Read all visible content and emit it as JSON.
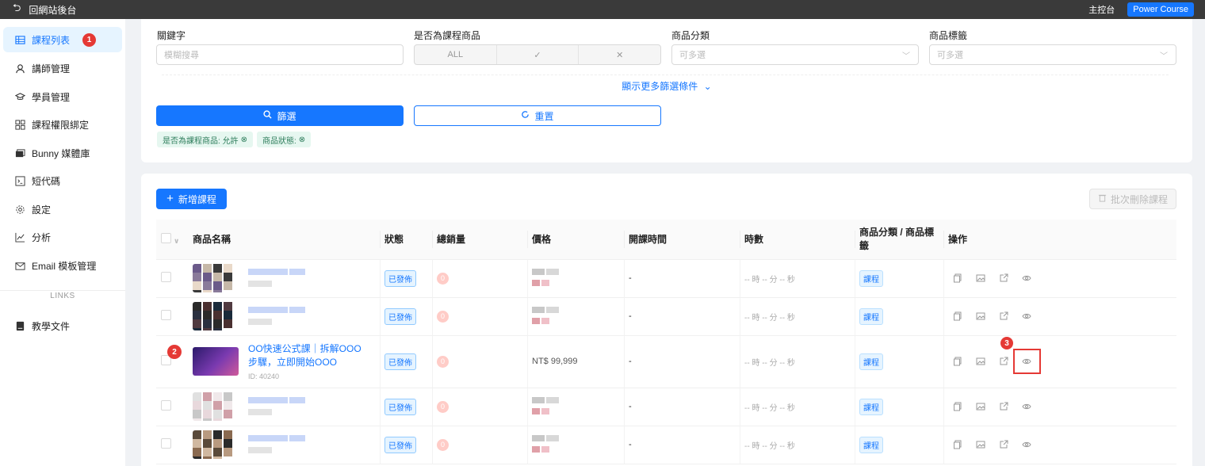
{
  "topbar": {
    "back_label": "回網站後台",
    "dashboard_label": "主控台",
    "brand_button": "Power Course"
  },
  "sidebar": {
    "items": [
      {
        "label": "課程列表",
        "icon": "table-icon",
        "active": true
      },
      {
        "label": "講師管理",
        "icon": "user-icon"
      },
      {
        "label": "學員管理",
        "icon": "graduation-icon"
      },
      {
        "label": "課程權限綁定",
        "icon": "grid-icon"
      },
      {
        "label": "Bunny 媒體庫",
        "icon": "media-icon"
      },
      {
        "label": "短代碼",
        "icon": "code-icon"
      },
      {
        "label": "設定",
        "icon": "gear-icon"
      },
      {
        "label": "分析",
        "icon": "chart-icon"
      },
      {
        "label": "Email 模板管理",
        "icon": "mail-icon"
      }
    ],
    "links_heading": "LINKS",
    "links": [
      {
        "label": "教學文件",
        "icon": "book-icon"
      }
    ]
  },
  "annotations": {
    "marker_1": "1",
    "marker_2": "2",
    "marker_3": "3"
  },
  "filters": {
    "keyword_label": "關鍵字",
    "keyword_placeholder": "模糊搜尋",
    "is_course_label": "是否為課程商品",
    "segments": [
      "ALL",
      "✓",
      "✕"
    ],
    "category_label": "商品分類",
    "category_placeholder": "可多選",
    "tag_label": "商品標籤",
    "tag_placeholder": "可多選",
    "more_label": "顯示更多篩選條件",
    "filter_button": "篩選",
    "reset_button": "重置",
    "chips": [
      "是否為課程商品: 允許",
      "商品狀態:"
    ]
  },
  "list": {
    "add_button": "新增課程",
    "bulk_delete_button": "批次刪除課程",
    "columns": [
      "商品名稱",
      "狀態",
      "總銷量",
      "價格",
      "開課時間",
      "時數",
      "商品分類 / 商品標籤",
      "操作"
    ],
    "rows": [
      {
        "status": "已發佈",
        "sales": "0",
        "price": "",
        "start": "-",
        "duration": "-- 時 -- 分 -- 秒",
        "category": "課程"
      },
      {
        "status": "已發佈",
        "sales": "0",
        "price": "",
        "start": "-",
        "duration": "-- 時 -- 分 -- 秒",
        "category": "課程"
      },
      {
        "status": "已發佈",
        "sales": "0",
        "price": "NT$  99,999",
        "start": "-",
        "duration": "-- 時 -- 分 -- 秒",
        "category": "課程",
        "title": "OO快速公式課｜拆解OOO步驟，立即開始OOO",
        "id_label": "ID: 40240"
      },
      {
        "status": "已發佈",
        "sales": "0",
        "price": "",
        "start": "-",
        "duration": "-- 時 -- 分 -- 秒",
        "category": "課程"
      },
      {
        "status": "已發佈",
        "sales": "0",
        "price": "",
        "start": "-",
        "duration": "-- 時 -- 分 -- 秒",
        "category": "課程"
      }
    ]
  },
  "colors": {
    "primary": "#1677ff",
    "marker": "#e53935",
    "topbar": "#3a3a3a"
  }
}
